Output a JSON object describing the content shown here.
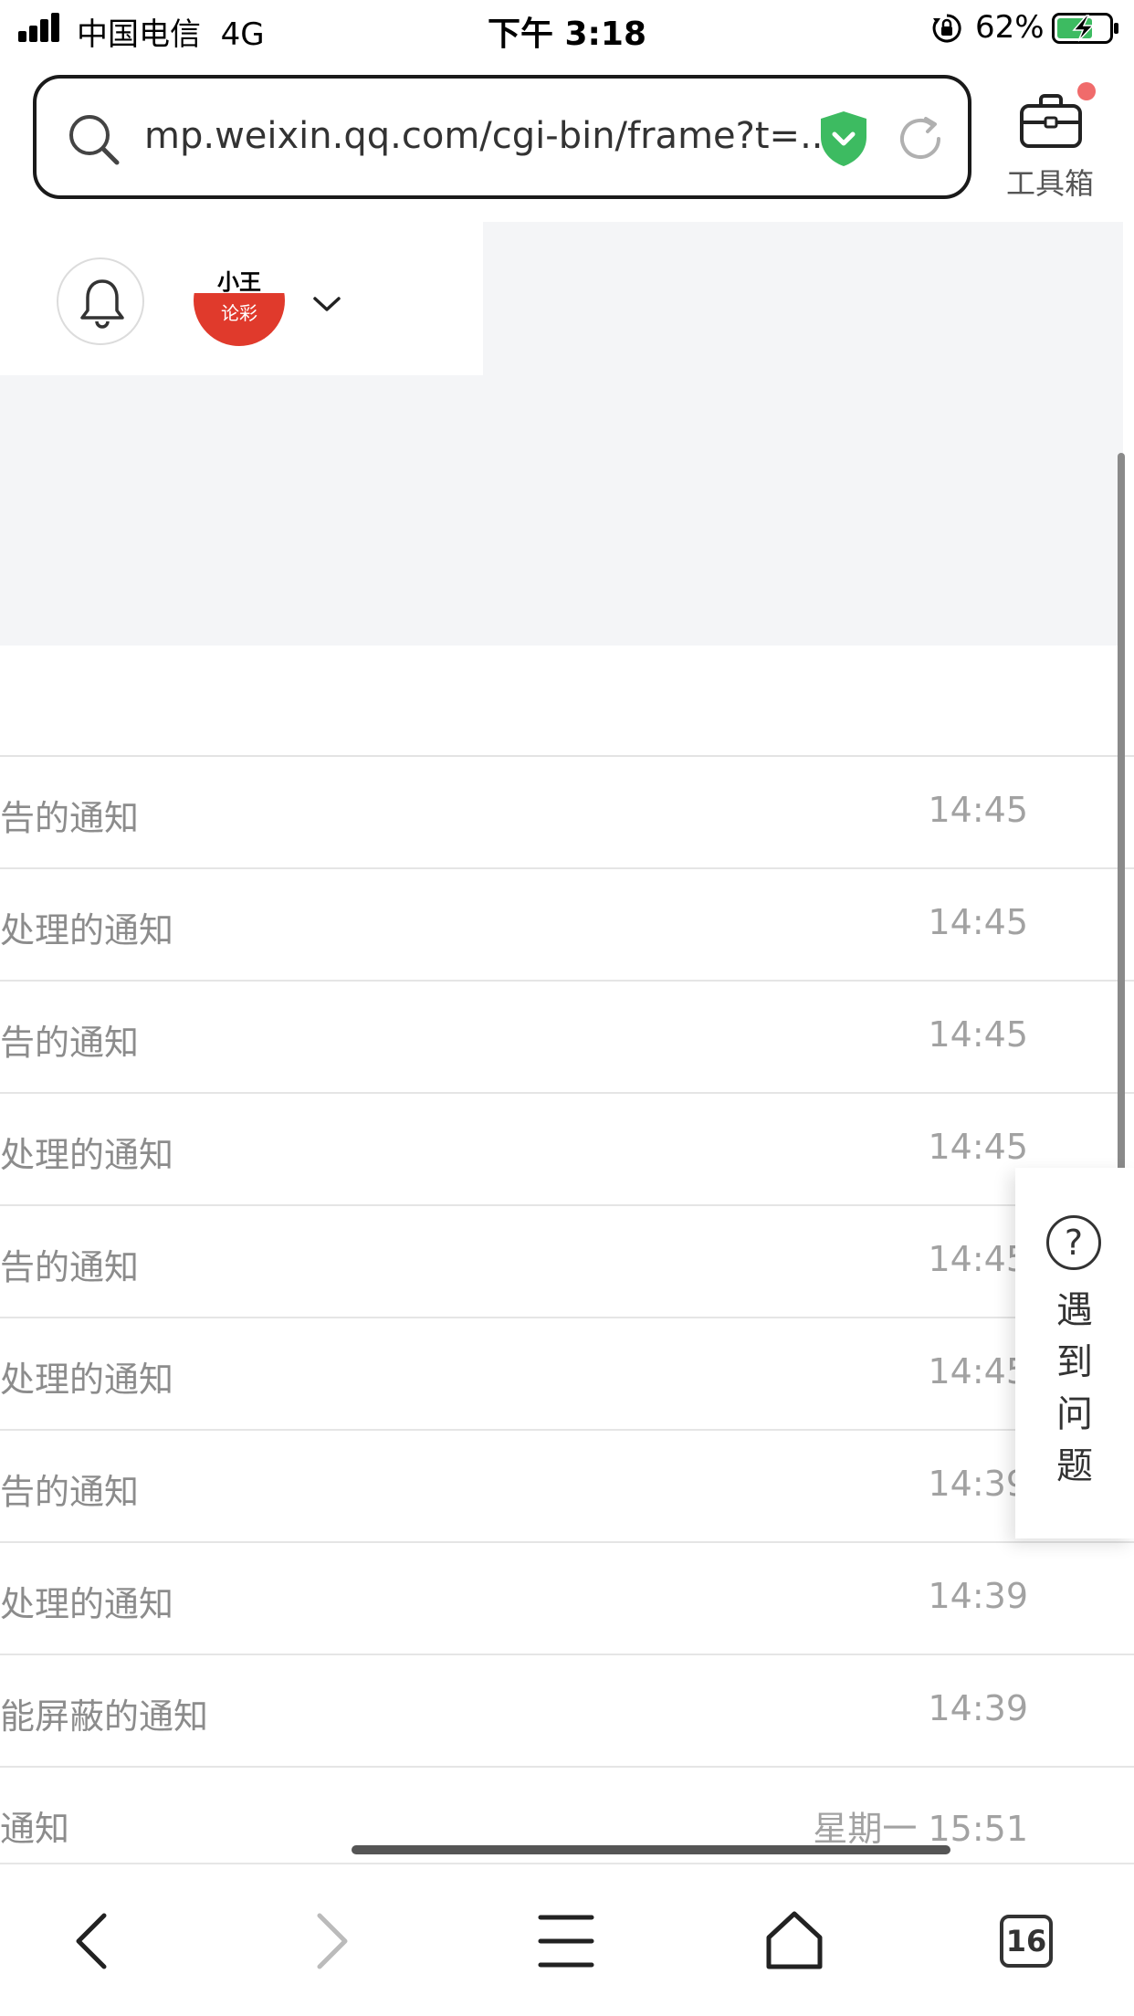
{
  "status_bar": {
    "carrier": "中国电信",
    "network": "4G",
    "time": "下午 3:18",
    "battery": "62%"
  },
  "address_bar": {
    "url": "mp.weixin.qq.com/cgi-bin/frame?t=..."
  },
  "toolbox": {
    "label": "工具箱"
  },
  "header": {
    "avatar_line1": "小王",
    "avatar_line2": "论彩"
  },
  "notices": [
    {
      "title": "告的通知",
      "time": "14:45"
    },
    {
      "title": "处理的通知",
      "time": "14:45"
    },
    {
      "title": "告的通知",
      "time": "14:45"
    },
    {
      "title": "处理的通知",
      "time": "14:45"
    },
    {
      "title": "告的通知",
      "time": "14:45"
    },
    {
      "title": "处理的通知",
      "time": "14:45"
    },
    {
      "title": "告的通知",
      "time": "14:39"
    },
    {
      "title": "处理的通知",
      "time": "14:39"
    },
    {
      "title": "能屏蔽的通知",
      "time": "14:39"
    },
    {
      "title": "通知",
      "time": "星期一 15:51"
    }
  ],
  "help": {
    "icon": "?",
    "label_lines": [
      "遇",
      "到",
      "问",
      "题"
    ]
  },
  "bottom_bar": {
    "tab_count": "16"
  },
  "colors": {
    "accent_green": "#3dbb61",
    "badge_red": "#f06b6b",
    "avatar_red": "#e03a2c",
    "text_gray": "#8c8c8c"
  }
}
